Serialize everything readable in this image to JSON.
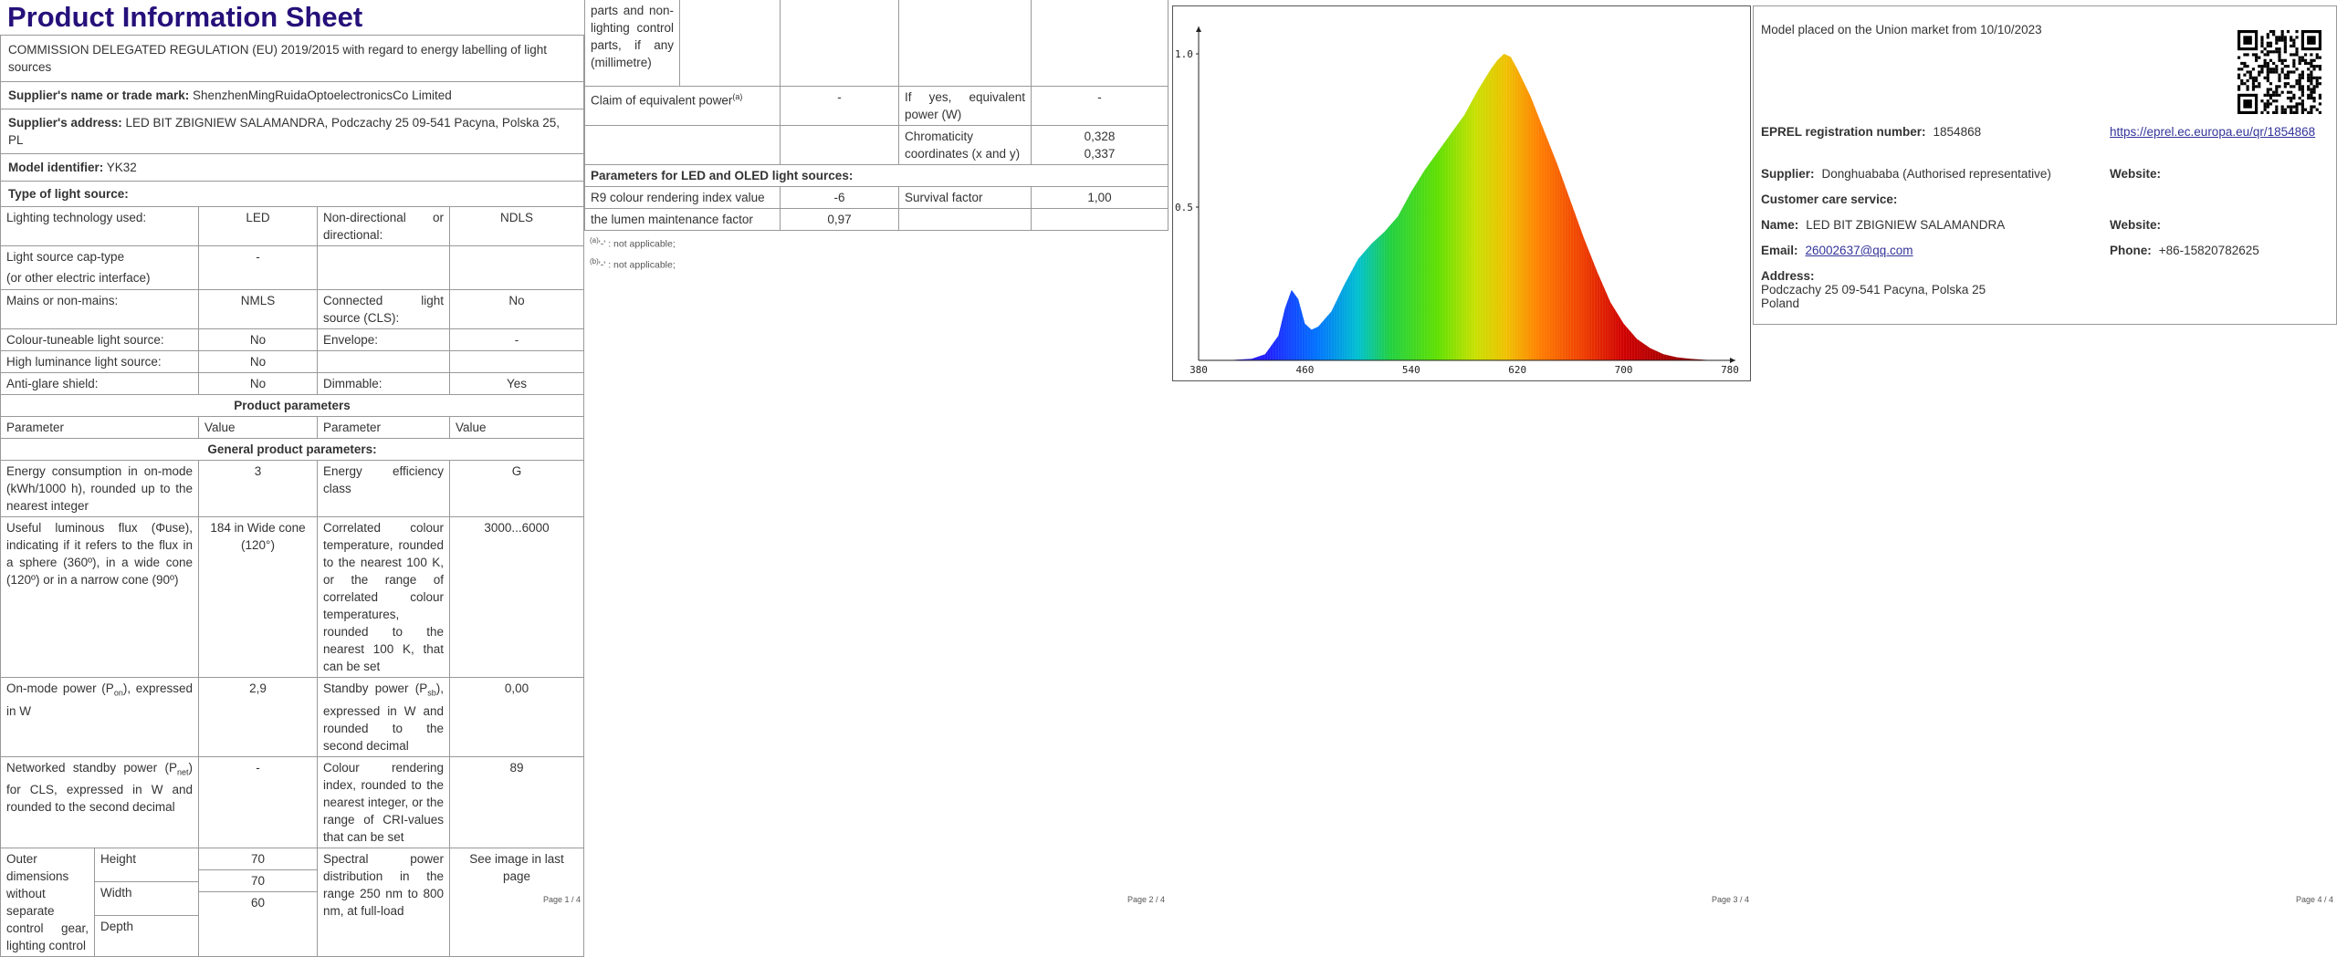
{
  "page1": {
    "title": "Product Information Sheet",
    "regulation": "COMMISSION DELEGATED REGULATION (EU) 2019/2015 with regard to energy labelling of light sources",
    "supplier_name_label": "Supplier's name or trade mark:",
    "supplier_name": "ShenzhenMingRuidaOptoelectronicsCo Limited",
    "supplier_address_label": "Supplier's address:",
    "supplier_address": "LED BIT ZBIGNIEW SALAMANDRA, Podczachy 25 09-541 Pacyna, Polska 25, PL",
    "model_label": "Model identifier:",
    "model": "YK32",
    "type_heading": "Type of light source:",
    "lighting_tech_label": "Lighting technology used:",
    "lighting_tech": "LED",
    "directional_label": "Non-directional or directional:",
    "directional": "NDLS",
    "cap_type_label": "Light source cap-type",
    "cap_type_label2": "(or other electric interface)",
    "cap_type": "-",
    "mains_label": "Mains or non-mains:",
    "mains": "NMLS",
    "connected_label": "Connected light source (CLS):",
    "connected": "No",
    "colour_tuneable_label": "Colour-tuneable light source:",
    "colour_tuneable": "No",
    "envelope_label": "Envelope:",
    "envelope": "-",
    "high_lum_label": "High luminance light source:",
    "high_lum": "No",
    "anti_glare_label": "Anti-glare shield:",
    "anti_glare": "No",
    "dimmable_label": "Dimmable:",
    "dimmable": "Yes",
    "product_params": "Product parameters",
    "col_parameter": "Parameter",
    "col_value": "Value",
    "general_params": "General product parameters:",
    "energy_cons_label": "Energy consumption in on-mode (kWh/1000 h), rounded up to the nearest integer",
    "energy_cons": "3",
    "energy_class_label": "Energy efficiency class",
    "energy_class": "G",
    "flux_label": "Useful luminous flux (Φuse), indicating if it refers to the flux in a sphere (360º), in a wide cone (120º) or in a narrow cone (90º)",
    "flux": "184 in Wide cone (120°)",
    "cct_label": "Correlated colour temperature, rounded to the nearest 100 K, or the range of correlated colour temperatures, rounded to the nearest 100 K, that can be set",
    "cct": "3000...6000",
    "pon_label": "On-mode power (P",
    "pon_sub": "on",
    "pon_label_end": "), expressed in W",
    "pon": "2,9",
    "psb_label": "Standby power (P",
    "psb_sub": "sb",
    "psb_label_end": "), expressed in W and rounded to the second decimal",
    "psb": "0,00",
    "pnet_label": "Networked standby power (P",
    "pnet_sub": "net",
    "pnet_label_end": ") for CLS, expressed in W and rounded to the second decimal",
    "pnet": "-",
    "cri_label": "Colour rendering index, rounded to the nearest integer, or the range of CRI-values that can be set",
    "cri": "89",
    "outer_dim_label": "Outer dimensions without separate control gear, lighting control",
    "height_label": "Height",
    "height": "70",
    "width_label": "Width",
    "width": "70",
    "depth_label": "Depth",
    "depth": "60",
    "spd_label": "Spectral power distribution in the range 250 nm to 800 nm, at full-load",
    "spd": "See image in last page",
    "page_no": "Page 1 / 4"
  },
  "page2": {
    "cont_label": "parts and non-lighting control parts, if any (millimetre)",
    "claim_label": "Claim of equivalent power",
    "claim_sup": "(a)",
    "claim": "-",
    "equiv_label": "If yes, equivalent power (W)",
    "equiv": "-",
    "chroma_label": "Chromaticity coordinates (x and y)",
    "chroma_x": "0,328",
    "chroma_y": "0,337",
    "led_params": "Parameters for LED and OLED light sources:",
    "r9_label": "R9 colour rendering index value",
    "r9": "-6",
    "survival_label": "Survival factor",
    "survival": "1,00",
    "lumen_maint_label": "the lumen maintenance factor",
    "lumen_maint": "0,97",
    "note_a_sup": "(a)",
    "note_a": "'-' : not applicable;",
    "note_b_sup": "(b)",
    "note_b": "'-' : not applicable;",
    "page_no": "Page 2 / 4"
  },
  "page3": {
    "page_no": "Page 3 / 4",
    "chart_data": {
      "type": "area",
      "title": "",
      "xlabel": "",
      "ylabel": "",
      "xlim": [
        380,
        780
      ],
      "ylim": [
        0,
        1.0
      ],
      "x_ticks": [
        "380",
        "460",
        "540",
        "620",
        "700",
        "780"
      ],
      "y_ticks": [
        "1.0",
        "0.5"
      ],
      "x": [
        380,
        400,
        420,
        430,
        440,
        445,
        450,
        455,
        460,
        465,
        470,
        480,
        490,
        500,
        510,
        520,
        530,
        540,
        550,
        560,
        570,
        580,
        590,
        600,
        605,
        610,
        615,
        620,
        630,
        640,
        650,
        660,
        670,
        680,
        690,
        700,
        710,
        720,
        730,
        740,
        750,
        760,
        770,
        780
      ],
      "values": [
        0.0,
        0.0,
        0.005,
        0.02,
        0.08,
        0.17,
        0.23,
        0.2,
        0.12,
        0.1,
        0.11,
        0.16,
        0.25,
        0.33,
        0.38,
        0.42,
        0.47,
        0.55,
        0.62,
        0.68,
        0.74,
        0.8,
        0.88,
        0.95,
        0.98,
        1.0,
        0.99,
        0.95,
        0.86,
        0.75,
        0.64,
        0.52,
        0.4,
        0.29,
        0.19,
        0.12,
        0.07,
        0.04,
        0.02,
        0.01,
        0.005,
        0.002,
        0.0,
        0.0
      ],
      "grid": false
    }
  },
  "page4": {
    "market_date": "Model placed on the Union market from 10/10/2023",
    "eprel_label": "EPREL registration number:",
    "eprel": "1854868",
    "eprel_url": "https://eprel.ec.europa.eu/qr/1854868",
    "supplier_label": "Supplier:",
    "supplier": "Donghuababa (Authorised representative)",
    "website_label": "Website:",
    "care_label": "Customer care service:",
    "name_label": "Name:",
    "name": "LED BIT ZBIGNIEW SALAMANDRA",
    "website2_label": "Website:",
    "email_label": "Email:",
    "email": "26002637@qq.com",
    "phone_label": "Phone:",
    "phone": "+86-15820782625",
    "address_label": "Address:",
    "address_line1": "Podczachy 25 09-541 Pacyna, Polska 25",
    "address_line2": "Poland",
    "page_no": "Page 4 / 4"
  }
}
